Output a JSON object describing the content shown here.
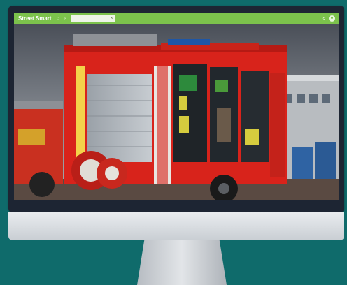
{
  "toolbar": {
    "app_title": "Street Smart",
    "search_value": "",
    "search_clear": "×"
  },
  "icons": [
    "home-icon",
    "search-icon",
    "share-icon",
    "user-icon",
    "close-icon"
  ],
  "colors": {
    "toolbar": "#7cc24c",
    "background": "#0f6b6b",
    "bezel": "#1d2533",
    "truck_red": "#d8231b"
  }
}
